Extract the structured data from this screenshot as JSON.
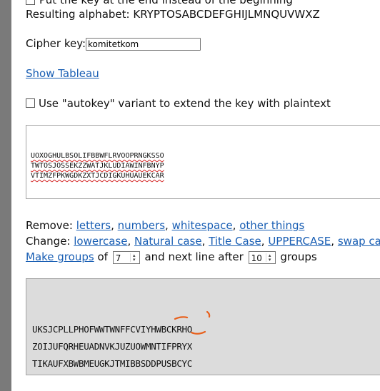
{
  "options": {
    "put_key_at_end_label": "Put the key at the end instead of the beginning",
    "resulting_alphabet_label": "Resulting alphabet:",
    "resulting_alphabet": "KRYPTOSABCDEFGHIJLMNQUVWXZ"
  },
  "cipher": {
    "key_label": "Cipher key:",
    "key_value": "komitetkom"
  },
  "show_tableau": "Show Tableau",
  "autokey_label": "Use \"autokey\" variant to extend the key with plaintext",
  "input_lines": [
    "UOXOGHULBSOLIFBBWFLRVOOPRNGKSSO",
    "TWTOSJOSSEKZZWATJKLUDIAWINFBNYP",
    "VTIMZFPKWGDKZXTJCDIGKUHUAUEKCAR"
  ],
  "remove": {
    "label": "Remove:",
    "letters": "letters",
    "numbers": "numbers",
    "whitespace": "whitespace",
    "other": "other things",
    "sep": ","
  },
  "change": {
    "label": "Change:",
    "lowercase": "lowercase",
    "natural": "Natural case",
    "title": "Title Case",
    "upper": "UPPERCASE",
    "swap": "swap case",
    "sep": ","
  },
  "groups": {
    "make_groups": "Make groups",
    "of": "of",
    "group_size": "7",
    "next_line_after": "and next line after",
    "line_groups": "10",
    "groups_word": "groups"
  },
  "output_lines": [
    "UKSJCPLLPHOFWWTWNFFCVIYHWBCKRHO",
    "ZOIJUFQRHEUADNVKJUZUOWMNTIFPRYX",
    "TIKAUFXBWBMEUGKJTMIBBSDDPUSBCYC"
  ],
  "colors": {
    "link": "#1a5fb4",
    "annotation": "#e8601c",
    "output_bg": "#dcdcdc"
  }
}
